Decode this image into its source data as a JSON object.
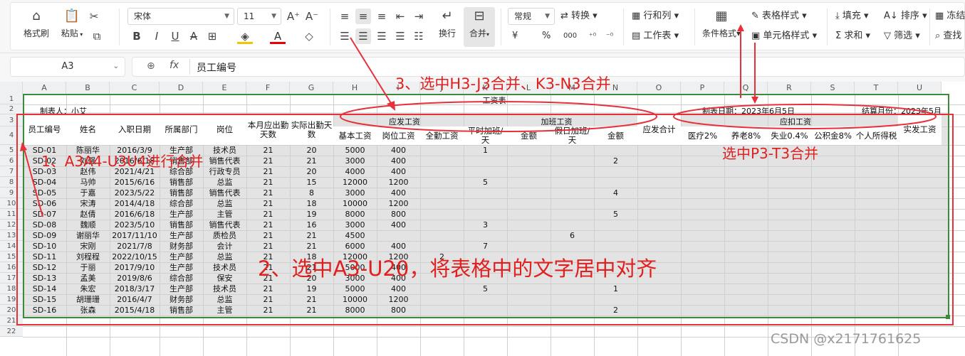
{
  "ribbon": {
    "format_painter": "格式刷",
    "paste": "粘贴",
    "font_name": "宋体",
    "font_size": "11",
    "wrap": "换行",
    "merge": "合并",
    "number_format": "常规",
    "convert": "转换",
    "rows_cols": "行和列",
    "worksheet": "工作表",
    "cond_format": "条件格式",
    "table_style": "表格样式",
    "cell_style": "单元格样式",
    "fill": "填充",
    "sort": "排序",
    "freeze": "冻结",
    "sum": "求和",
    "filter": "筛选",
    "find": "查找",
    "currency": "¥",
    "percent": "%",
    "thousands": "000"
  },
  "formula_bar": {
    "cell_ref": "A3",
    "fx": "fx",
    "content": "员工编号"
  },
  "columns": [
    "A",
    "B",
    "C",
    "D",
    "E",
    "F",
    "G",
    "H",
    "I",
    "J",
    "K",
    "L",
    "M",
    "N",
    "O",
    "P",
    "Q",
    "R",
    "S",
    "T",
    "U"
  ],
  "rows": [
    "1",
    "2",
    "3",
    "4",
    "5",
    "6",
    "7",
    "8",
    "9",
    "10",
    "11",
    "12",
    "13",
    "14",
    "15",
    "16",
    "17",
    "18",
    "19",
    "20",
    "21",
    "22"
  ],
  "sheet": {
    "title": "工资表",
    "maker": "制表人：小艾",
    "date": "制表日期：2023年6月5日",
    "settle": "结算月份：2023年5月",
    "group_yingfa": "应发工资",
    "group_jiaban": "加班工资",
    "group_yingkou": "应扣工资",
    "headers": [
      "员工编号",
      "姓名",
      "入职日期",
      "所属部门",
      "岗位",
      "本月应出勤天数",
      "实际出勤天数",
      "基本工资",
      "岗位工资",
      "全勤工资",
      "平时加班/天",
      "金额",
      "假日加班/天",
      "金额",
      "应发合计",
      "医疗2%",
      "养老8%",
      "失业0.4%",
      "公积金8%",
      "个人所得税",
      "实发工资"
    ],
    "data": [
      [
        "SD-01",
        "陈丽华",
        "2016/3/9",
        "生产部",
        "技术员",
        "21",
        "20",
        "5000",
        "400",
        "",
        "1",
        "",
        "",
        "",
        "",
        "",
        "",
        "",
        "",
        "",
        ""
      ],
      [
        "SD-02",
        "刘强",
        "2016/6/18",
        "销售部",
        "销售代表",
        "21",
        "21",
        "3000",
        "400",
        "",
        "",
        "",
        "",
        "2",
        "",
        "",
        "",
        "",
        "",
        "",
        ""
      ],
      [
        "SD-03",
        "赵伟",
        "2021/4/21",
        "综合部",
        "行政专员",
        "21",
        "20",
        "4000",
        "400",
        "",
        "",
        "",
        "",
        "",
        "",
        "",
        "",
        "",
        "",
        "",
        ""
      ],
      [
        "SD-04",
        "马帅",
        "2015/6/16",
        "销售部",
        "总监",
        "21",
        "15",
        "12000",
        "1200",
        "",
        "5",
        "",
        "",
        "",
        "",
        "",
        "",
        "",
        "",
        "",
        ""
      ],
      [
        "SD-05",
        "于嘉",
        "2023/5/22",
        "销售部",
        "销售代表",
        "21",
        "8",
        "3000",
        "400",
        "",
        "",
        "",
        "",
        "4",
        "",
        "",
        "",
        "",
        "",
        "",
        ""
      ],
      [
        "SD-06",
        "宋涛",
        "2014/4/18",
        "综合部",
        "总监",
        "21",
        "18",
        "10000",
        "1200",
        "",
        "",
        "",
        "",
        "",
        "",
        "",
        "",
        "",
        "",
        "",
        ""
      ],
      [
        "SD-07",
        "赵倩",
        "2016/6/18",
        "生产部",
        "主管",
        "21",
        "19",
        "8000",
        "800",
        "",
        "",
        "",
        "",
        "5",
        "",
        "",
        "",
        "",
        "",
        "",
        ""
      ],
      [
        "SD-08",
        "魏顺",
        "2023/5/10",
        "销售部",
        "销售代表",
        "21",
        "16",
        "3000",
        "400",
        "",
        "3",
        "",
        "",
        "",
        "",
        "",
        "",
        "",
        "",
        "",
        ""
      ],
      [
        "SD-09",
        "谢丽华",
        "2017/11/10",
        "生产部",
        "质检员",
        "21",
        "21",
        "4500",
        "",
        "",
        "",
        "",
        "6",
        "",
        "",
        "",
        "",
        "",
        "",
        "",
        ""
      ],
      [
        "SD-10",
        "宋刚",
        "2021/7/8",
        "财务部",
        "会计",
        "21",
        "21",
        "6000",
        "400",
        "",
        "7",
        "",
        "",
        "",
        "",
        "",
        "",
        "",
        "",
        "",
        ""
      ],
      [
        "SD-11",
        "刘程程",
        "2022/10/15",
        "生产部",
        "总监",
        "21",
        "18",
        "12000",
        "1200",
        "2",
        "",
        "",
        "",
        "",
        "",
        "",
        "",
        "",
        "",
        "",
        ""
      ],
      [
        "SD-12",
        "于丽",
        "2017/9/10",
        "生产部",
        "技术员",
        "21",
        "21",
        "5000",
        "400",
        "",
        "",
        "",
        "",
        "",
        "",
        "",
        "",
        "",
        "",
        "",
        ""
      ],
      [
        "SD-13",
        "孟美",
        "2019/8/6",
        "综合部",
        "保安",
        "21",
        "20",
        "3000",
        "400",
        "",
        "",
        "",
        "",
        "",
        "",
        "",
        "",
        "",
        "",
        "",
        ""
      ],
      [
        "SD-14",
        "朱宏",
        "2018/3/17",
        "生产部",
        "技术员",
        "21",
        "19",
        "5000",
        "400",
        "",
        "5",
        "",
        "",
        "1",
        "",
        "",
        "",
        "",
        "",
        "",
        ""
      ],
      [
        "SD-15",
        "胡珊珊",
        "2016/4/7",
        "财务部",
        "总监",
        "21",
        "21",
        "10000",
        "1200",
        "",
        "",
        "",
        "",
        "",
        "",
        "",
        "",
        "",
        "",
        "",
        ""
      ],
      [
        "SD-16",
        "张森",
        "2015/4/18",
        "销售部",
        "主管",
        "21",
        "21",
        "8000",
        "800",
        "",
        "",
        "",
        "",
        "2",
        "",
        "",
        "",
        "",
        "",
        "",
        ""
      ]
    ]
  },
  "annotations": {
    "a1": "1、A3A4-U3U4进行合并",
    "a2": "2、选中A3-U20，将表格中的文字居中对齐",
    "a3": "3、选中H3-J3合并、K3-N3合并",
    "a4": "选中P3-T3合并"
  },
  "watermark": "CSDN @x2171761625"
}
